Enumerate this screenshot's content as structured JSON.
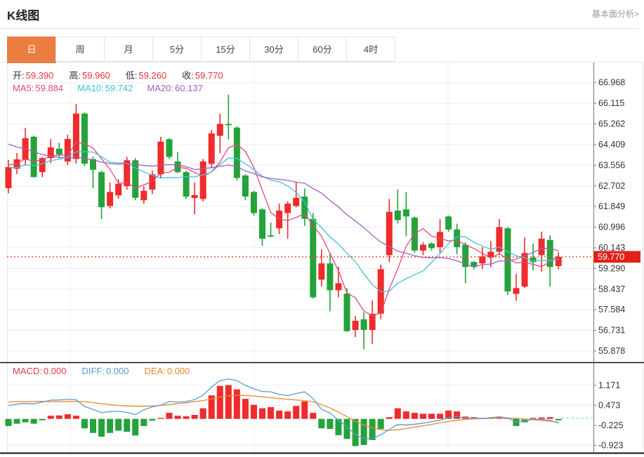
{
  "header": {
    "title": "K线图",
    "link": "基本面分析>"
  },
  "tabs": {
    "active": "日",
    "items": [
      "日",
      "周",
      "月",
      "5分",
      "15分",
      "30分",
      "60分",
      "4时"
    ]
  },
  "legend": {
    "ohlc": [
      {
        "label": "开:",
        "value": "59.390"
      },
      {
        "label": "高:",
        "value": "59.960"
      },
      {
        "label": "低:",
        "value": "59.260"
      },
      {
        "label": "收:",
        "value": "59.770"
      }
    ],
    "ohlc_value_color": "#e53333",
    "ma": [
      {
        "label": "MA5:",
        "value": "59.884",
        "color": "#e8457c"
      },
      {
        "label": "MA10:",
        "value": "59.742",
        "color": "#3fc3dd"
      },
      {
        "label": "MA20:",
        "value": "60.137",
        "color": "#a55cc0"
      }
    ],
    "macd": [
      {
        "label": "MACD:",
        "value": "0.000",
        "color": "#e53d3d"
      },
      {
        "label": "DIFF:",
        "value": "0.000",
        "color": "#5b9bd5"
      },
      {
        "label": "DEA:",
        "value": "0.000",
        "color": "#f0872e"
      }
    ]
  },
  "axis": {
    "main_ticks": [
      "66.968",
      "66.115",
      "65.262",
      "64.409",
      "63.556",
      "62.702",
      "61.849",
      "60.996",
      "60.143",
      "59.290",
      "58.437",
      "57.584",
      "56.731",
      "55.878"
    ],
    "macd_ticks": [
      "1.171",
      "0.473",
      "-0.225",
      "-0.923"
    ],
    "price_marker": "59.770"
  },
  "colors": {
    "up": "#ef2b2b",
    "down": "#23a33a",
    "ma5": "#e8457c",
    "ma10": "#3fc3dd",
    "ma20": "#a55cc0",
    "diff_line": "#5b9bd5",
    "dea_line": "#f0872e",
    "price_line": "#f0503c",
    "badge_bg": "#e32119",
    "grid": "#ededed",
    "axis_line": "#777777",
    "tick_text": "#333333",
    "zero_dash": "#8fd8ea"
  },
  "chart_data": {
    "type": "candlestick_with_macd",
    "title": "K线图",
    "legend_position": "top-left",
    "grid": true,
    "value_axis": {
      "max_tick": 66.968,
      "tick_step": 0.853,
      "min_tick": 55.878
    },
    "macd_axis": {
      "ticks": [
        1.171,
        0.473,
        -0.225,
        -0.923
      ]
    },
    "current_price": 59.77,
    "grid_x_positions": [
      100,
      362,
      638
    ],
    "candles_ochl": [
      [
        62.61,
        63.48,
        63.77,
        62.4
      ],
      [
        63.41,
        63.8,
        64.06,
        63.19
      ],
      [
        63.77,
        64.67,
        65.1,
        63.56
      ],
      [
        64.73,
        63.07,
        64.78,
        63.04
      ],
      [
        63.27,
        63.85,
        63.9,
        63.07
      ],
      [
        63.85,
        64.29,
        64.64,
        63.65
      ],
      [
        64.24,
        64.0,
        64.48,
        63.85
      ],
      [
        63.71,
        64.64,
        64.81,
        63.56
      ],
      [
        63.81,
        65.69,
        66.08,
        63.62
      ],
      [
        65.69,
        63.62,
        65.74,
        63.52
      ],
      [
        63.81,
        63.37,
        63.91,
        62.6
      ],
      [
        63.27,
        61.82,
        63.33,
        61.33
      ],
      [
        61.87,
        62.45,
        62.84,
        61.77
      ],
      [
        62.31,
        62.79,
        62.98,
        62.17
      ],
      [
        62.69,
        63.76,
        63.9,
        62.55
      ],
      [
        63.76,
        62.21,
        63.85,
        62.11
      ],
      [
        62.11,
        62.5,
        62.69,
        61.96
      ],
      [
        62.55,
        63.18,
        63.33,
        62.36
      ],
      [
        63.18,
        64.53,
        64.73,
        63.03
      ],
      [
        64.63,
        63.9,
        64.67,
        63.81
      ],
      [
        63.71,
        63.27,
        64.1,
        63.22
      ],
      [
        63.27,
        62.26,
        63.32,
        62.16
      ],
      [
        62.2,
        62.32,
        62.84,
        61.53
      ],
      [
        62.16,
        63.71,
        63.81,
        62.06
      ],
      [
        63.61,
        64.87,
        65.02,
        63.42
      ],
      [
        64.77,
        65.26,
        65.69,
        64.05
      ],
      [
        65.26,
        65.21,
        66.47,
        64.63
      ],
      [
        65.11,
        63.03,
        65.16,
        62.93
      ],
      [
        63.13,
        62.26,
        63.18,
        62.11
      ],
      [
        62.45,
        61.58,
        62.5,
        61.48
      ],
      [
        61.73,
        60.52,
        61.77,
        60.23
      ],
      [
        60.66,
        60.61,
        61.19,
        60.57
      ],
      [
        60.95,
        61.68,
        61.97,
        60.71
      ],
      [
        61.58,
        61.97,
        62.06,
        60.52
      ],
      [
        61.87,
        62.21,
        62.84,
        61.82
      ],
      [
        62.26,
        61.34,
        62.6,
        61.05
      ],
      [
        61.34,
        58.1,
        61.58,
        58.05
      ],
      [
        58.83,
        59.5,
        60.08,
        58.54
      ],
      [
        59.5,
        58.39,
        59.93,
        57.52
      ],
      [
        58.39,
        58.68,
        59.36,
        58.1
      ],
      [
        58.25,
        56.7,
        58.48,
        56.66
      ],
      [
        56.75,
        57.13,
        57.33,
        56.46
      ],
      [
        57.19,
        56.75,
        57.48,
        55.95
      ],
      [
        56.75,
        57.42,
        57.96,
        56.17
      ],
      [
        57.42,
        59.26,
        59.45,
        57.19
      ],
      [
        59.84,
        61.63,
        62.16,
        59.55
      ],
      [
        61.68,
        61.29,
        62.55,
        61.15
      ],
      [
        61.73,
        61.44,
        62.45,
        60.62
      ],
      [
        61.39,
        60.03,
        61.44,
        59.93
      ],
      [
        60.03,
        60.27,
        60.37,
        59.84
      ],
      [
        60.32,
        60.13,
        60.37,
        60.03
      ],
      [
        60.17,
        60.8,
        61.33,
        59.93
      ],
      [
        61.44,
        60.9,
        61.48,
        60.8
      ],
      [
        60.9,
        60.17,
        61.14,
        59.88
      ],
      [
        60.27,
        59.35,
        60.37,
        58.68
      ],
      [
        59.56,
        59.35,
        59.6,
        59.26
      ],
      [
        59.5,
        59.79,
        60.17,
        59.26
      ],
      [
        59.74,
        59.98,
        60.42,
        59.35
      ],
      [
        59.98,
        61.0,
        61.33,
        59.84
      ],
      [
        60.95,
        58.34,
        61.0,
        58.19
      ],
      [
        58.24,
        58.48,
        59.06,
        57.95
      ],
      [
        58.54,
        59.93,
        60.57,
        58.48
      ],
      [
        59.74,
        59.55,
        60.32,
        59.21
      ],
      [
        59.84,
        60.52,
        60.81,
        59.16
      ],
      [
        60.47,
        59.35,
        60.66,
        58.54
      ],
      [
        59.39,
        59.77,
        59.96,
        59.26
      ]
    ],
    "ma_periods": [
      5,
      10,
      20
    ],
    "ma_prehistory": [
      66.4,
      66.2,
      66.0,
      65.8,
      65.9,
      65.6,
      65.3,
      65.1,
      64.9,
      64.7,
      64.3,
      63.9,
      63.6,
      63.3,
      63.1,
      63.0,
      63.5,
      63.7,
      63.6,
      63.55
    ],
    "macd": {
      "hist": [
        -0.25,
        -0.17,
        -0.12,
        -0.17,
        -0.05,
        0.11,
        0.12,
        0.16,
        0.11,
        -0.33,
        -0.49,
        -0.62,
        -0.49,
        -0.41,
        -0.45,
        -0.58,
        -0.25,
        -0.06,
        0.02,
        0.21,
        0.11,
        0.09,
        0.14,
        0.37,
        0.82,
        1.15,
        1.18,
        1.03,
        0.7,
        0.49,
        0.37,
        0.41,
        0.29,
        0.26,
        0.45,
        0.61,
        0.21,
        -0.33,
        -0.35,
        -0.57,
        -0.7,
        -0.95,
        -0.91,
        -0.74,
        -0.35,
        0.06,
        0.37,
        0.26,
        0.21,
        0.18,
        0.18,
        0.18,
        0.29,
        0.26,
        0.08,
        0.06,
        0.0,
        0.05,
        0.08,
        0.0,
        -0.25,
        -0.12,
        0.02,
        0.05,
        0.06,
        -0.05
      ],
      "dea": [
        0.59,
        0.6,
        0.6,
        0.61,
        0.61,
        0.6,
        0.6,
        0.6,
        0.61,
        0.6,
        0.57,
        0.53,
        0.5,
        0.47,
        0.45,
        0.44,
        0.44,
        0.45,
        0.47,
        0.5,
        0.53,
        0.56,
        0.6,
        0.64,
        0.7,
        0.76,
        0.8,
        0.82,
        0.82,
        0.8,
        0.77,
        0.74,
        0.71,
        0.68,
        0.66,
        0.64,
        0.6,
        0.5,
        0.38,
        0.24,
        0.08,
        -0.08,
        -0.22,
        -0.32,
        -0.38,
        -0.4,
        -0.38,
        -0.34,
        -0.29,
        -0.24,
        -0.19,
        -0.14,
        -0.09,
        -0.05,
        -0.02,
        0.0,
        0.01,
        0.02,
        0.03,
        0.03,
        0.02,
        -0.01,
        -0.03,
        -0.05,
        -0.08,
        -0.12
      ],
      "diff_formula": "dea + hist/2"
    }
  }
}
